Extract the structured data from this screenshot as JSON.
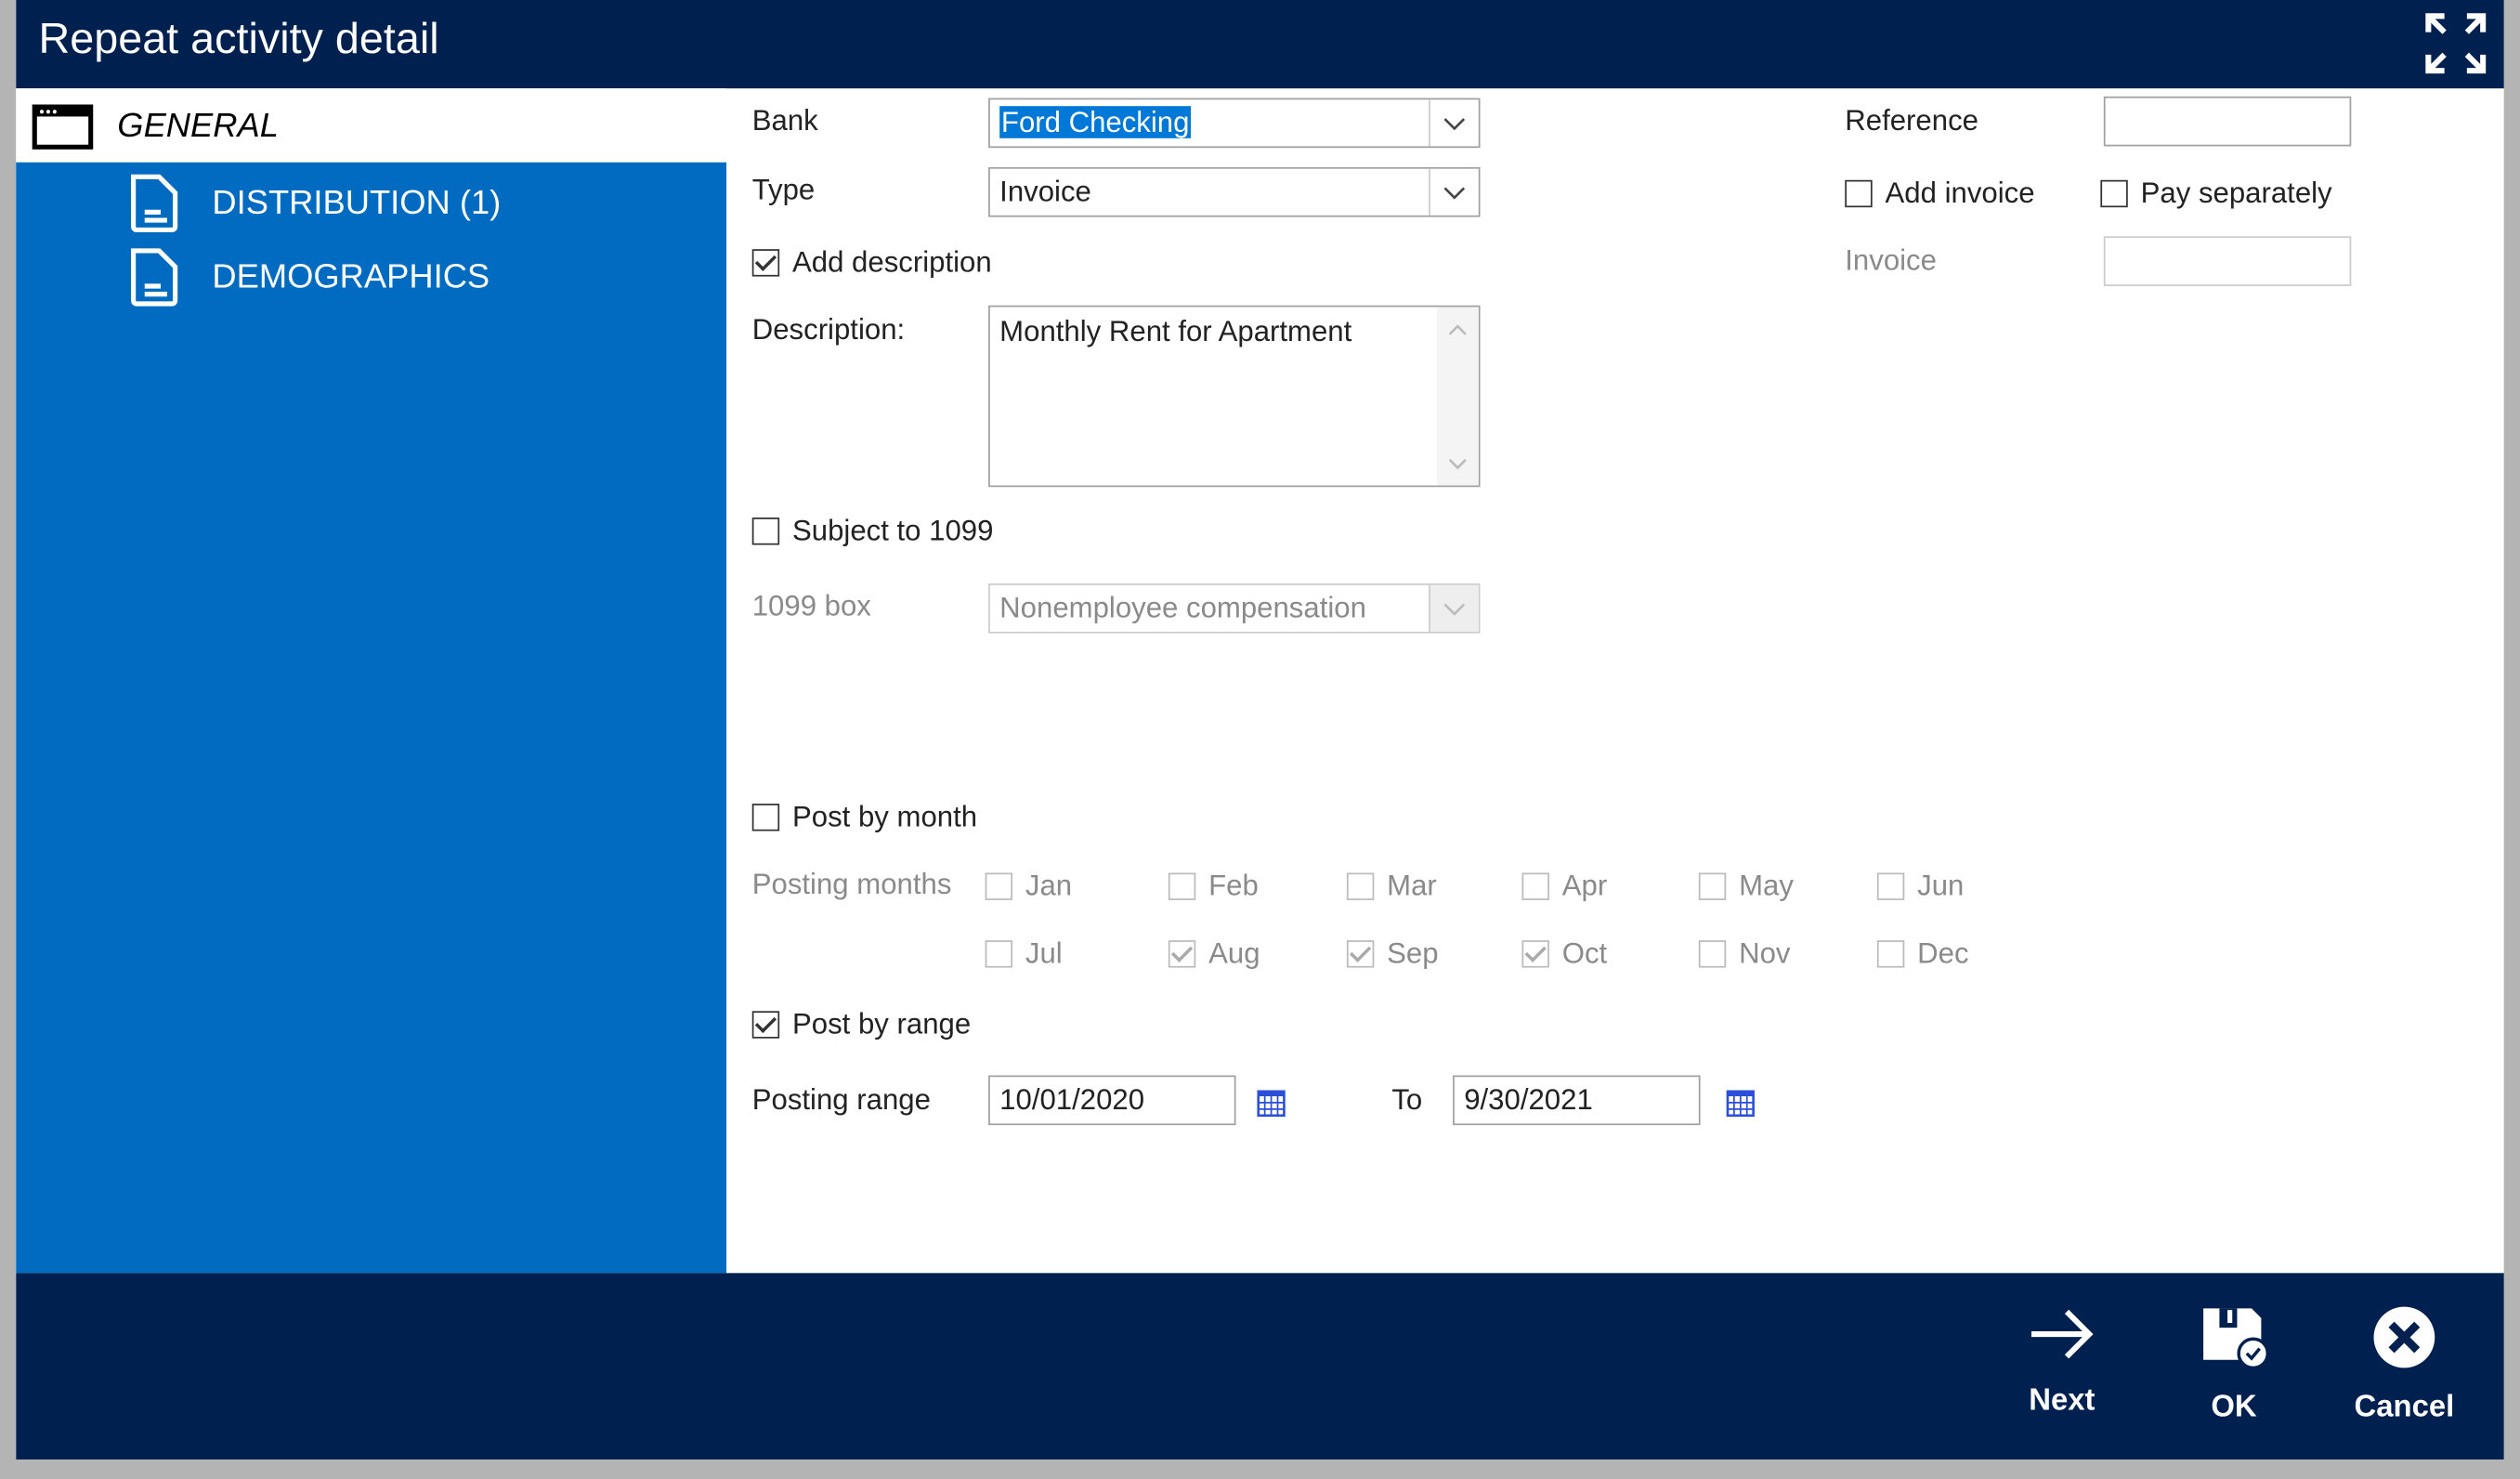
{
  "window": {
    "title": "Repeat activity detail"
  },
  "sidebar": {
    "items": [
      {
        "label": "GENERAL"
      },
      {
        "label": "DISTRIBUTION (1)"
      },
      {
        "label": "DEMOGRAPHICS"
      }
    ]
  },
  "form": {
    "bank_label": "Bank",
    "bank_value": "Ford Checking",
    "type_label": "Type",
    "type_value": "Invoice",
    "add_description_label": "Add description",
    "add_description_checked": true,
    "description_label": "Description:",
    "description_value": "Monthly Rent for Apartment",
    "subject_1099_label": "Subject to 1099",
    "subject_1099_checked": false,
    "box_1099_label": "1099 box",
    "box_1099_value": "Nonemployee compensation",
    "reference_label": "Reference",
    "reference_value": "",
    "add_invoice_label": "Add invoice",
    "pay_separately_label": "Pay separately",
    "invoice_label": "Invoice",
    "invoice_value": "",
    "post_by_month_label": "Post by month",
    "posting_months_label": "Posting months",
    "months": [
      {
        "label": "Jan",
        "checked": false
      },
      {
        "label": "Feb",
        "checked": false
      },
      {
        "label": "Mar",
        "checked": false
      },
      {
        "label": "Apr",
        "checked": false
      },
      {
        "label": "May",
        "checked": false
      },
      {
        "label": "Jun",
        "checked": false
      },
      {
        "label": "Jul",
        "checked": false
      },
      {
        "label": "Aug",
        "checked": true
      },
      {
        "label": "Sep",
        "checked": true
      },
      {
        "label": "Oct",
        "checked": true
      },
      {
        "label": "Nov",
        "checked": false
      },
      {
        "label": "Dec",
        "checked": false
      }
    ],
    "post_by_range_label": "Post by range",
    "posting_range_label": "Posting range",
    "range_from": "10/01/2020",
    "to_label": "To",
    "range_to": "9/30/2021"
  },
  "footer": {
    "next": "Next",
    "ok": "OK",
    "cancel": "Cancel"
  }
}
